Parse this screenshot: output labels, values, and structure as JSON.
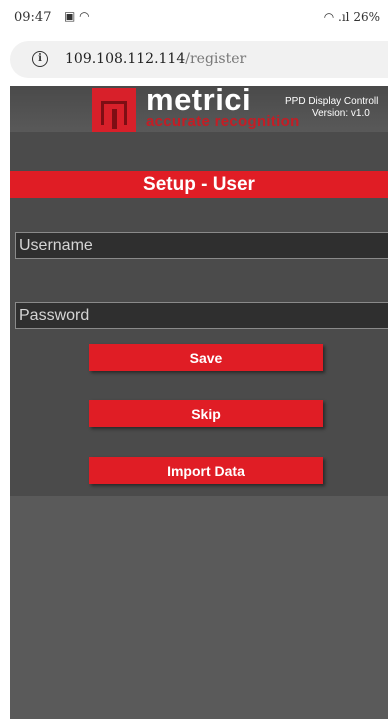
{
  "status_bar": {
    "time": "09:47",
    "left_icons": "▣ ◠",
    "right_text": "◠ .ıl 26%"
  },
  "browser": {
    "host": "109.108.112.114",
    "path": "/register"
  },
  "header": {
    "brand_name": "metrici",
    "brand_tagline": "accurate recognition",
    "app_title": "PPD Display Controll",
    "app_version": "Version: v1.0"
  },
  "setup": {
    "title": "Setup - User",
    "username_placeholder": "Username",
    "password_placeholder": "Password",
    "save_label": "Save",
    "skip_label": "Skip",
    "import_label": "Import Data"
  },
  "colors": {
    "accent": "#e01d25",
    "page_bg": "#5a5a5a",
    "field_bg": "#2f2f2f"
  }
}
